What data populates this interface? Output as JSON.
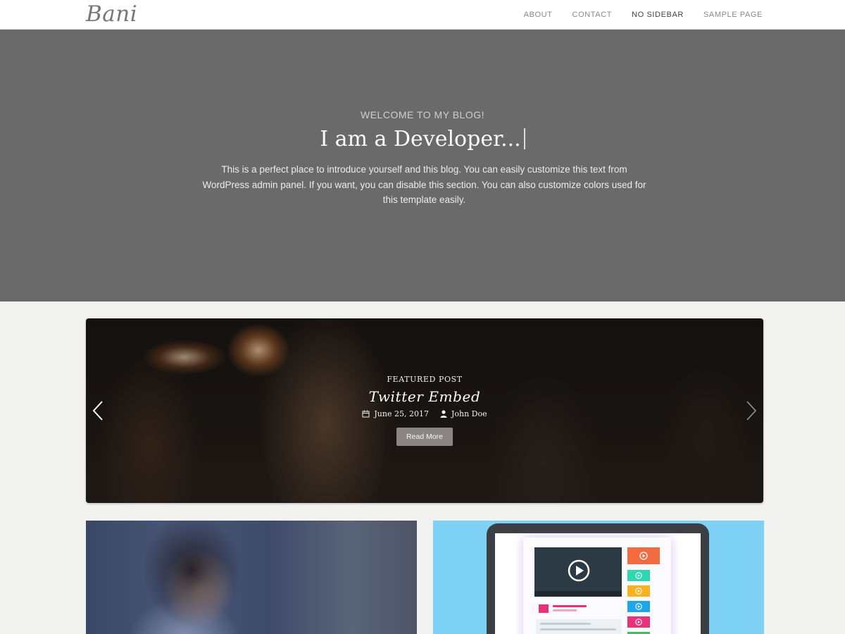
{
  "header": {
    "logo": "Bani",
    "nav": [
      {
        "label": "ABOUT",
        "active": false
      },
      {
        "label": "CONTACT",
        "active": false
      },
      {
        "label": "NO SIDEBAR",
        "active": true
      },
      {
        "label": "SAMPLE PAGE",
        "active": false
      }
    ]
  },
  "hero": {
    "kicker": "WELCOME TO MY BLOG!",
    "title": "I am a Developer...",
    "text": "This is a perfect place to introduce yourself and this blog. You can easily customize this text from WordPress admin panel. If you want, you can disable this section. You can also customize colors used for this template easily."
  },
  "featured": {
    "label": "FEATURED POST",
    "title": "Twitter Embed",
    "date": "June 25, 2017",
    "author": "John Doe",
    "button": "Read More",
    "icons": {
      "date": "calendar-icon",
      "author": "user-icon",
      "prev": "chevron-left-icon",
      "next": "chevron-right-icon"
    }
  },
  "colors": {
    "hero_bg": "#6a6a6a",
    "page_bg": "#f2f2f0",
    "button_bg": "#8a8582",
    "card_right_bg": "#7cd1f5"
  }
}
